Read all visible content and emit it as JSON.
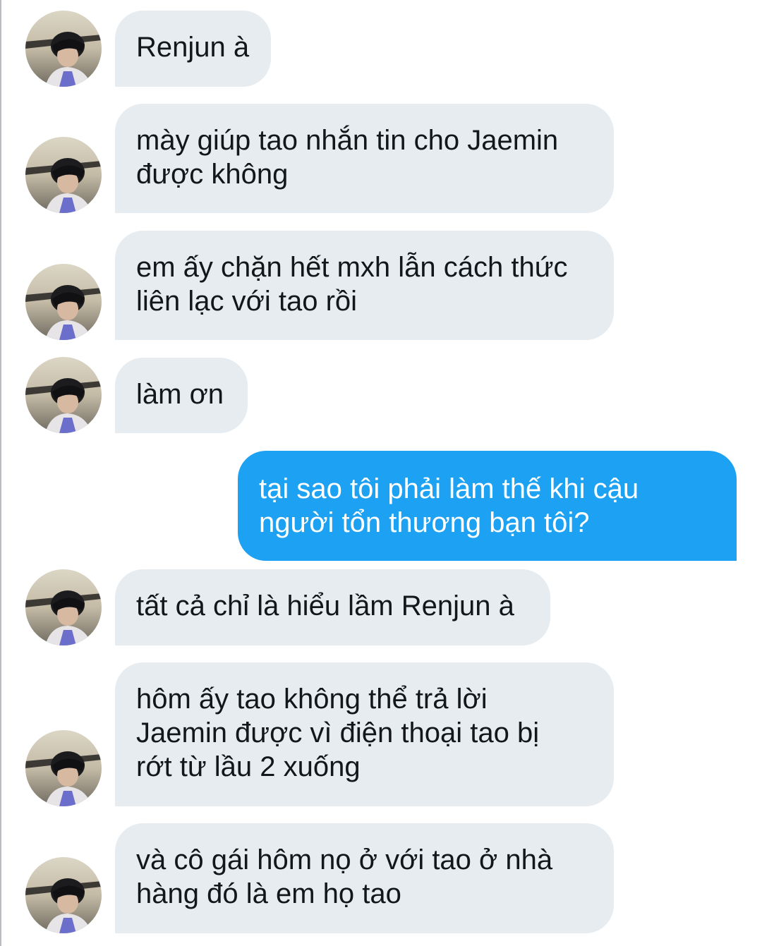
{
  "conversation": {
    "messages": [
      {
        "sender": "contact",
        "text": "Renjun à"
      },
      {
        "sender": "contact",
        "text": "mày giúp tao nhắn tin cho Jaemin\nđược không"
      },
      {
        "sender": "contact",
        "text": "em ấy chặn hết mxh lẫn cách thức\nliên lạc với tao rồi"
      },
      {
        "sender": "contact",
        "text": "làm ơn"
      },
      {
        "sender": "me",
        "text": "tại sao tôi phải làm thế khi cậu\nngười tổn thương bạn tôi?"
      },
      {
        "sender": "contact",
        "text": "tất cả chỉ là hiểu lầm Renjun à"
      },
      {
        "sender": "contact",
        "text": "hôm ấy tao không thể trả lời\nJaemin được vì điện thoại tao bị\nrớt từ lầu 2 xuống"
      },
      {
        "sender": "contact",
        "text": "và cô gái hôm nọ ở với tao ở nhà\nhàng đó là em họ tao"
      }
    ]
  },
  "colors": {
    "incoming_bubble": "#e6ecf0",
    "outgoing_bubble": "#1da1f2",
    "incoming_text": "#14171a",
    "outgoing_text": "#ffffff"
  },
  "icons": {
    "avatar": "contact-avatar-photo"
  }
}
